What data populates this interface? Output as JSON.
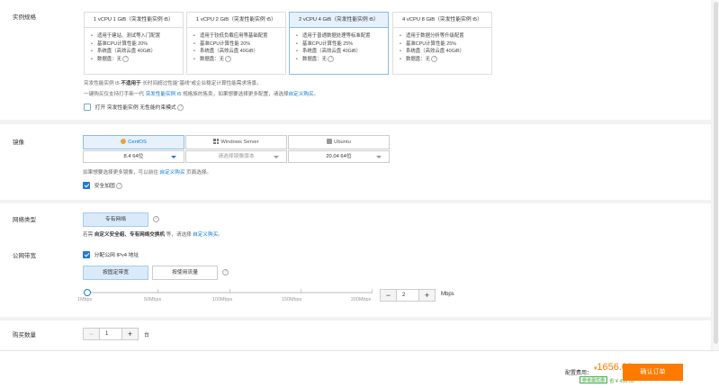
{
  "spec": {
    "label": "实例规格",
    "cards": [
      {
        "title": "1 vCPU 1 GiB（突发性能实例 t5）",
        "items": [
          "适用于建站、测试等入门配置",
          "基准CPU计算性能 20%",
          "系统盘（高效云盘 40GiB）",
          "数据盘：无"
        ]
      },
      {
        "title": "1 vCPU 2 GiB（突发性能实例 t5）",
        "items": [
          "适用于较低负载应用等基础配置",
          "基准CPU计算性能 20%",
          "系统盘（高效云盘 40GiB）",
          "数据盘：无"
        ]
      },
      {
        "title": "2 vCPU 4 GiB（突发性能实例 t5）",
        "items": [
          "适用于普通数据处理等标准配置",
          "基准CPU计算性能 25%",
          "系统盘（高效云盘 40GiB）",
          "数据盘：无"
        ]
      },
      {
        "title": "4 vCPU 8 GiB（突发性能实例 t5）",
        "items": [
          "适用于数据分析等升级配置",
          "基准CPU计算性能 25%",
          "系统盘（高效云盘 40GiB）",
          "数据盘：无"
        ]
      }
    ],
    "note1_pre": "突发性能实例 t5",
    "note1_bold": "不适用于",
    "note1_post": "长时间超过性能“基线”或企业稳定计算性能需求场景。",
    "note2_pre": "一键购买仅支持打手新一代",
    "note2_link": "突发性能实例 t5",
    "note2_mid": "规格族的售卖，如果想要选择更多配置，请选择",
    "note2_link2": "自定义购买",
    "note2_end": "。",
    "unlimited_label": "打开 突发性能实例 无性能约束模式"
  },
  "image": {
    "label": "镜像",
    "options": [
      {
        "name": "CentOS",
        "version": "8.4 64位"
      },
      {
        "name": "Windows Server",
        "version": "请选择镜像版本"
      },
      {
        "name": "Ubuntu",
        "version": "20.04 64位"
      }
    ],
    "note_pre": "如果想要选择更多镜像，可以前往",
    "note_link": "自定义购买",
    "note_post": "页面选择。",
    "security_label": "安全加固"
  },
  "network": {
    "label": "网络类型",
    "vpc": "专有网络",
    "note_pre": "若需",
    "note_bold": "自定义安全组、专有网络交换机",
    "note_mid": "等，请选择",
    "note_link": "自定义购买",
    "note_end": "。"
  },
  "bandwidth": {
    "label": "公网带宽",
    "ipv4_label": "分配公网 IPv4 地址",
    "modes": [
      "按固定带宽",
      "按使用流量"
    ],
    "ticks": [
      "1Mbps",
      "50Mbps",
      "100Mbps",
      "150Mbps",
      "200Mbps"
    ],
    "value": "2",
    "unit": "Mbps"
  },
  "purchase": {
    "label": "购买数量",
    "value": "1",
    "unit": "台"
  },
  "footer": {
    "fee_label": "配置费用：",
    "currency": "¥",
    "price": "1656.00",
    "promo_badge": "参考最优惠",
    "save_text": "省 ¥ 456.00",
    "confirm": "确认订单"
  },
  "colors": {
    "accent": "#1e7ad6",
    "price": "#ff7a00",
    "confirm": "#ff7a00",
    "promo": "#4caf50"
  }
}
